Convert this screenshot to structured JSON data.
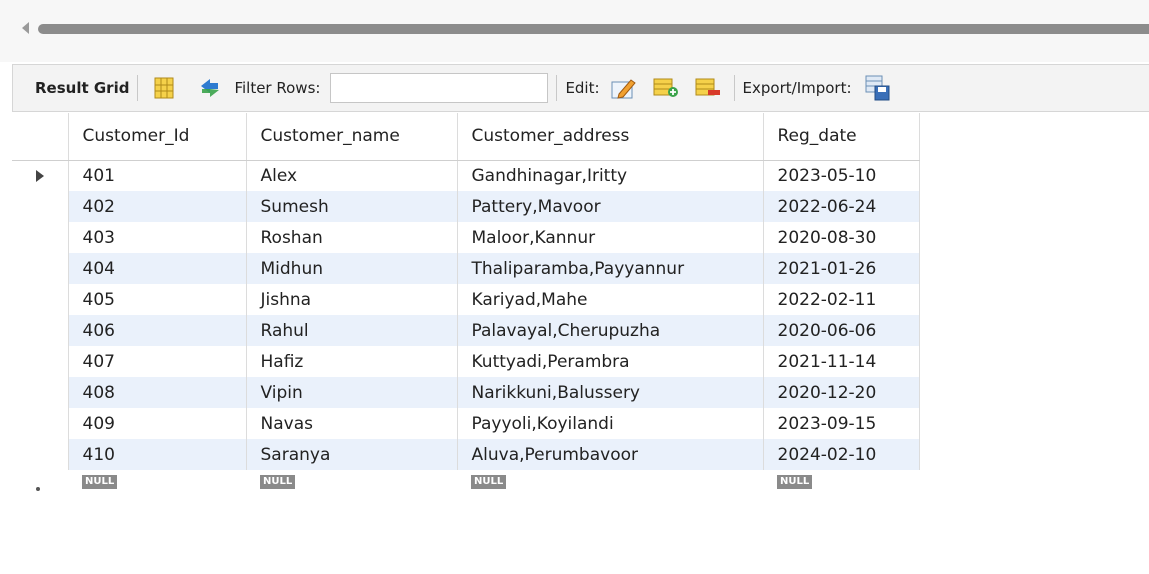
{
  "toolbar": {
    "result_grid_label": "Result Grid",
    "filter_label": "Filter Rows:",
    "filter_value": "",
    "edit_label": "Edit:",
    "export_label": "Export/Import:"
  },
  "columns": [
    "Customer_Id",
    "Customer_name",
    "Customer_address",
    "Reg_date"
  ],
  "rows": [
    [
      "401",
      "Alex",
      "Gandhinagar,Iritty",
      "2023-05-10"
    ],
    [
      "402",
      "Sumesh",
      "Pattery,Mavoor",
      "2022-06-24"
    ],
    [
      "403",
      "Roshan",
      "Maloor,Kannur",
      "2020-08-30"
    ],
    [
      "404",
      "Midhun",
      "Thaliparamba,Payyannur",
      "2021-01-26"
    ],
    [
      "405",
      "Jishna",
      "Kariyad,Mahe",
      "2022-02-11"
    ],
    [
      "406",
      "Rahul",
      "Palavayal,Cherupuzha",
      "2020-06-06"
    ],
    [
      "407",
      "Hafiz",
      "Kuttyadi,Perambra",
      "2021-11-14"
    ],
    [
      "408",
      "Vipin",
      "Narikkuni,Balussery",
      "2020-12-20"
    ],
    [
      "409",
      "Navas",
      "Payyoli,Koyilandi",
      "2023-09-15"
    ],
    [
      "410",
      "Saranya",
      "Aluva,Perumbavoor",
      "2024-02-10"
    ]
  ],
  "null_label": "NULL",
  "colors": {
    "alt_row": "#eaf1fb",
    "null_badge": "#8a8a8a",
    "toolbar_bg": "#f3f3f3"
  },
  "icons": [
    "grid-toggle-icon",
    "refresh-icon",
    "edit-cell-icon",
    "add-row-icon",
    "delete-row-icon",
    "export-icon"
  ]
}
